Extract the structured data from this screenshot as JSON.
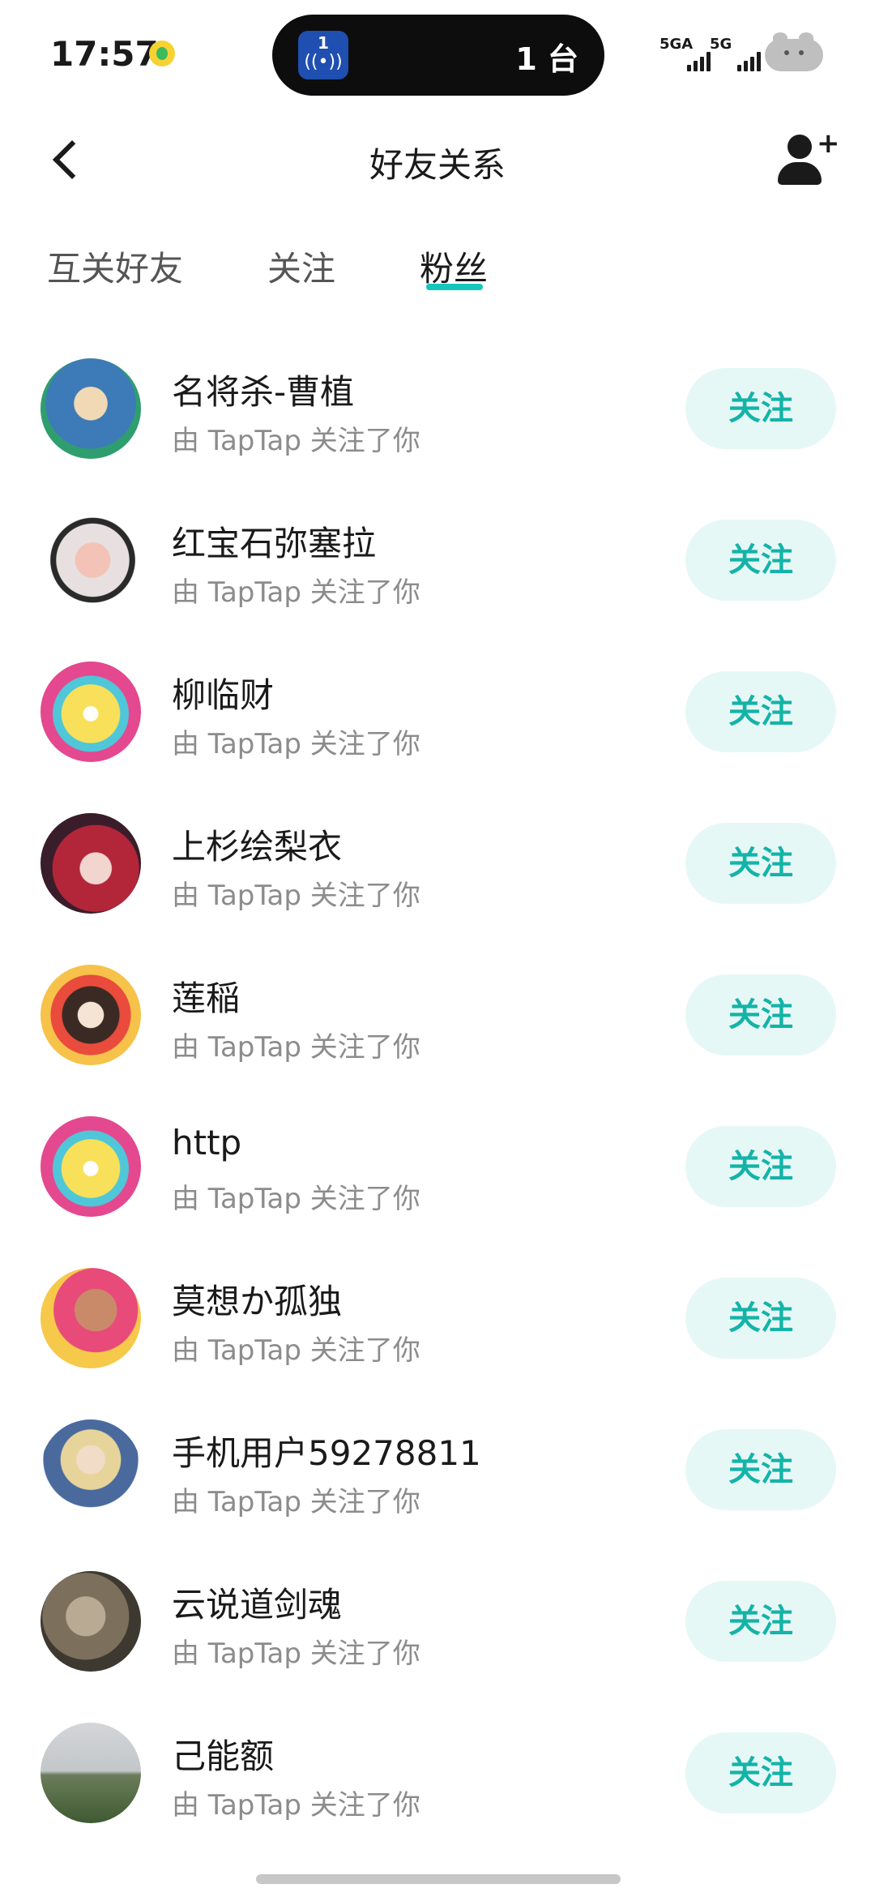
{
  "status_bar": {
    "time": "17:57",
    "island_badge": "1",
    "island_wave": "((•))",
    "island_text": "1 台",
    "signal1_label": "5GA",
    "signal2_label": "5G"
  },
  "header": {
    "title": "好友关系",
    "back_icon": "chevron-left-icon",
    "add_icon": "add-user-icon"
  },
  "tabs": [
    {
      "label": "互关好友",
      "active": false
    },
    {
      "label": "关注",
      "active": false
    },
    {
      "label": "粉丝",
      "active": true
    }
  ],
  "colors": {
    "accent": "#15c5bb",
    "button_bg": "#e6f8f6",
    "button_text": "#14b3a8",
    "subtext": "#8c8c8c"
  },
  "users": [
    {
      "name": "名将杀-曹植",
      "subtitle": "由 TapTap 关注了你",
      "button": "关注",
      "avatar": "avatar-image"
    },
    {
      "name": "红宝石弥塞拉",
      "subtitle": "由 TapTap 关注了你",
      "button": "关注",
      "avatar": "avatar-image"
    },
    {
      "name": "柳临财",
      "subtitle": "由 TapTap 关注了你",
      "button": "关注",
      "avatar": "avatar-image"
    },
    {
      "name": "上杉绘梨衣",
      "subtitle": "由 TapTap 关注了你",
      "button": "关注",
      "avatar": "avatar-image"
    },
    {
      "name": "莲稲",
      "subtitle": "由 TapTap 关注了你",
      "button": "关注",
      "avatar": "avatar-image"
    },
    {
      "name": "http",
      "subtitle": "由 TapTap 关注了你",
      "button": "关注",
      "avatar": "avatar-image"
    },
    {
      "name": "莫想か孤独",
      "subtitle": "由 TapTap 关注了你",
      "button": "关注",
      "avatar": "avatar-image"
    },
    {
      "name": "手机用户59278811",
      "subtitle": "由 TapTap 关注了你",
      "button": "关注",
      "avatar": "avatar-image"
    },
    {
      "name": "云说道剑魂",
      "subtitle": "由 TapTap 关注了你",
      "button": "关注",
      "avatar": "avatar-image"
    },
    {
      "name": "己能额",
      "subtitle": "由 TapTap 关注了你",
      "button": "关注",
      "avatar": "avatar-image"
    }
  ]
}
